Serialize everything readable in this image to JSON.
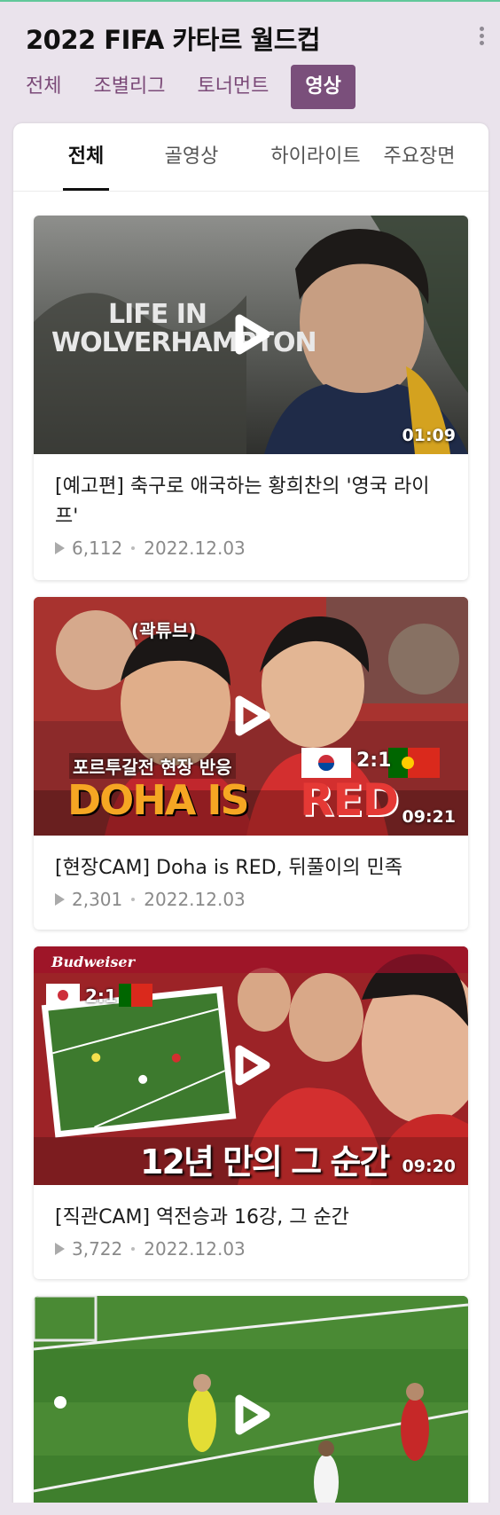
{
  "header": {
    "title": "2022 FIFA 카타르 월드컵"
  },
  "category_tabs": [
    {
      "label": "전체",
      "active": false
    },
    {
      "label": "조별리그",
      "active": false
    },
    {
      "label": "토너먼트",
      "active": false
    },
    {
      "label": "영상",
      "active": true
    }
  ],
  "video_tabs": [
    {
      "label": "전체",
      "active": true
    },
    {
      "label": "골영상",
      "active": false
    },
    {
      "label": "하이라이트",
      "active": false
    },
    {
      "label": "주요장면",
      "active": false
    }
  ],
  "videos": [
    {
      "title": "[예고편] 축구로 애국하는 황희찬의 '영국 라이프'",
      "duration": "01:09",
      "views": "6,112",
      "date": "2022.12.03",
      "thumb_text": [
        "LIFE IN",
        "WOLVERHAMPTON"
      ]
    },
    {
      "title": "[현장CAM] Doha is RED, 뒤풀이의 민족",
      "duration": "09:21",
      "views": "2,301",
      "date": "2022.12.03",
      "thumb_text": [
        "(곽튜브)",
        "포르투갈전 현장 반응",
        "DOHA IS",
        "RED",
        "2:1"
      ]
    },
    {
      "title": "[직관CAM] 역전승과 16강, 그 순간",
      "duration": "09:20",
      "views": "3,722",
      "date": "2022.12.03",
      "thumb_text": [
        "Budweiser",
        "2:1",
        "12년 만의 그 순간"
      ]
    },
    {
      "title": "",
      "duration": "",
      "views": "",
      "date": "",
      "thumb_text": []
    }
  ],
  "icons": {
    "more": "more-vertical-icon",
    "play": "play-icon",
    "views": "play-count-icon"
  },
  "colors": {
    "accent": "#7a4f7b",
    "tab_text": "#7b4a78",
    "background": "#eae3ec"
  }
}
